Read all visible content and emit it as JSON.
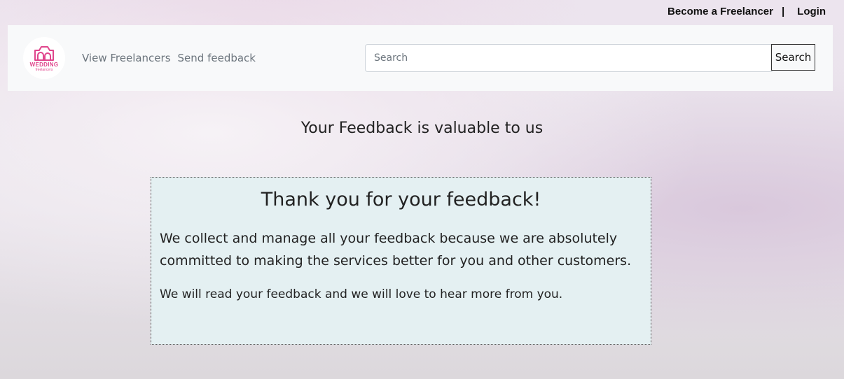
{
  "topbar": {
    "become_freelancer": "Become a Freelancer",
    "separator": "|",
    "login": "Login"
  },
  "navbar": {
    "logo": {
      "line1": "WEDDING",
      "line2": "freelancers",
      "icon": "camera-icon"
    },
    "links": [
      "View Freelancers",
      "Send feedback"
    ],
    "search_placeholder": "Search",
    "search_button": "Search"
  },
  "page": {
    "heading": "Your Feedback is valuable to us"
  },
  "card": {
    "title": "Thank you for your feedback!",
    "paragraph1": "We collect and manage all your feedback because we are absolutely committed to making the services better for you and other customers.",
    "paragraph2": "We will read your feedback and we will love to hear more from you."
  },
  "colors": {
    "brand": "#e0458c",
    "card_bg": "#e4f0f2",
    "navbar_bg": "#f8f9fa"
  }
}
